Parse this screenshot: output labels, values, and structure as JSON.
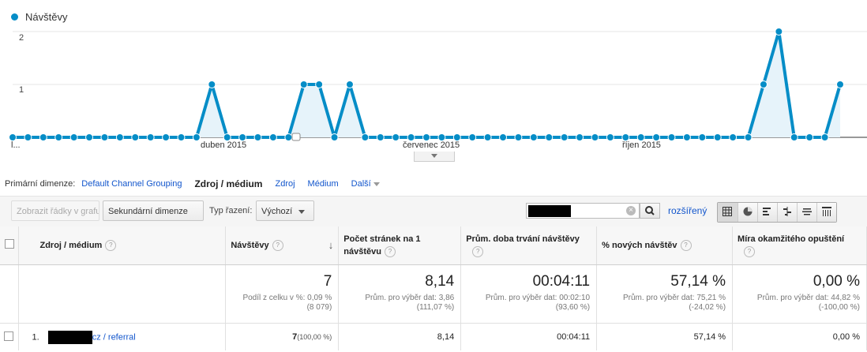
{
  "chart_data": {
    "type": "area",
    "series": [
      {
        "name": "Návštěvy",
        "color": "#058dc7",
        "values": [
          0,
          0,
          0,
          0,
          0,
          0,
          0,
          0,
          0,
          0,
          0,
          0,
          0,
          1,
          0,
          0,
          0,
          0,
          0,
          1,
          1,
          0,
          1,
          0,
          0,
          0,
          0,
          0,
          0,
          0,
          0,
          0,
          0,
          0,
          0,
          0,
          0,
          0,
          0,
          0,
          0,
          0,
          0,
          0,
          0,
          0,
          0,
          0,
          0,
          1,
          2,
          0,
          0,
          0,
          1
        ]
      }
    ],
    "yticks": [
      "2",
      "1"
    ],
    "ylim": [
      0,
      2
    ],
    "x_tick_labels": [
      "l...",
      "duben 2015",
      "červenec 2015",
      "říjen 2015"
    ],
    "grid": true
  },
  "legend": {
    "label": "Návštěvy"
  },
  "dimensions": {
    "label": "Primární dimenze:",
    "items": [
      "Default Channel Grouping",
      "Zdroj / médium",
      "Zdroj",
      "Médium",
      "Další"
    ]
  },
  "toolbar": {
    "plot_rows": "Zobrazit řádky v grafu",
    "secondary_dim": "Sekundární dimenze",
    "sort_label": "Typ řazení:",
    "sort_value": "Výchozí",
    "advanced": "rozšířený"
  },
  "table": {
    "headers": {
      "source": "Zdroj / médium",
      "visits": "Návštěvy",
      "pages": "Počet stránek na 1 návštěvu",
      "duration": "Prům. doba trvání návštěvy",
      "new": "% nových návštěv",
      "bounce": "Míra okamžitého opuštění"
    },
    "summary": {
      "visits": "7",
      "visits_sub": "Podíl z celku v %: 0,09 %",
      "visits_sub2": "(8 079)",
      "pages": "8,14",
      "pages_sub": "Prům. pro výběr dat: 3,86",
      "pages_sub2": "(111,07 %)",
      "duration": "00:04:11",
      "duration_sub": "Prům. pro výběr dat: 00:02:10",
      "duration_sub2": "(93,60 %)",
      "new": "57,14 %",
      "new_sub": "Prům. pro výběr dat: 75,21 %",
      "new_sub2": "(-24,02 %)",
      "bounce": "0,00 %",
      "bounce_sub": "Prům. pro výběr dat: 44,82 %",
      "bounce_sub2": "(-100,00 %)"
    },
    "row1": {
      "index": "1.",
      "source": "cz / referral",
      "visits": "7",
      "visits_pct": "(100,00 %)",
      "pages": "8,14",
      "duration": "00:04:11",
      "new": "57,14 %",
      "bounce": "0,00 %"
    }
  }
}
